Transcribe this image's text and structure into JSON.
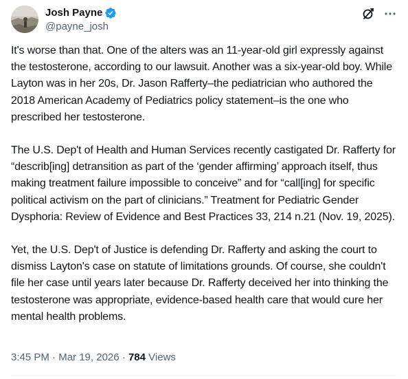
{
  "author": {
    "display_name": "Josh Payne",
    "handle": "@payne_josh",
    "verified": true,
    "verified_color": "#1d9bf0"
  },
  "icons": {
    "verified": "verified-badge-icon",
    "grok": "grok-icon",
    "more": "more-options-icon"
  },
  "tweet": {
    "paragraphs": [
      "It's worse than that. One of the alters was an 11-year-old girl expressly against the testosterone, according to our lawsuit. Another was a six-year-old boy. While Layton was in her 20s, Dr. Jason Rafferty–the pediatrician who authored the 2018 American Academy of Pediatrics policy statement–is the one who prescribed her testosterone.",
      "The U.S. Dep't of Health and Human Services recently castigated Dr. Rafferty for “describ[ing] detransition as part of the ‘gender affirming’ approach itself, thus making treatment failure impossible to conceive” and for “call[ing] for specific political activism on the part of clinicians.” Treatment for Pediatric Gender Dysphoria: Review of Evidence and Best Practices 33, 214 n.21 (Nov. 19, 2025).",
      "Yet, the U.S. Dep't of Justice is defending Dr. Rafferty and asking the court to dismiss Layton's case on statute of limitations grounds. Of course, she couldn't file her case until years later because Dr. Rafferty deceived her into thinking the testosterone was appropriate, evidence-based health care that would cure her mental health problems."
    ]
  },
  "meta": {
    "time": "3:45 PM",
    "separator": "·",
    "date": "Mar 19, 2026",
    "views_count": "784",
    "views_label": "Views"
  }
}
